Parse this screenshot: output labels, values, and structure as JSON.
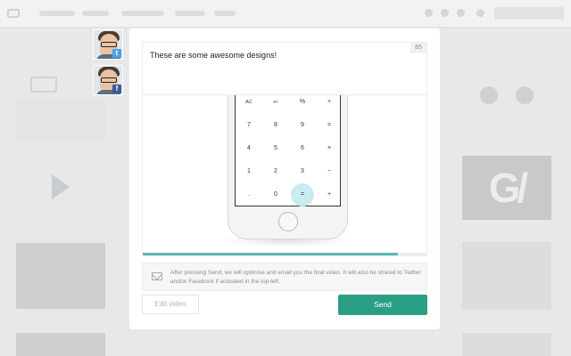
{
  "composer": {
    "message": "These are some awesome designs!",
    "char_count": "85"
  },
  "calculator_keys": [
    [
      "AC",
      "+/-",
      "%",
      "+"
    ],
    [
      "7",
      "8",
      "9",
      "="
    ],
    [
      "4",
      "5",
      "6",
      "×"
    ],
    [
      "1",
      "2",
      "3",
      "−"
    ],
    [
      ".",
      "0",
      "=",
      "+"
    ]
  ],
  "video_progress": 0.9,
  "info": {
    "text": "After pressing Send, we will optimise and email you the final video. It will also be shared to Twitter and/or Facebook if activated in the top-left."
  },
  "buttons": {
    "edit_video": "Edit video",
    "send": "Send"
  },
  "background": {
    "tile_logo_text": "G/"
  },
  "colors": {
    "accent": "#2b9f84",
    "progress": "#5db8b9",
    "twitter": "#4aa1eb",
    "facebook": "#3b5998"
  }
}
